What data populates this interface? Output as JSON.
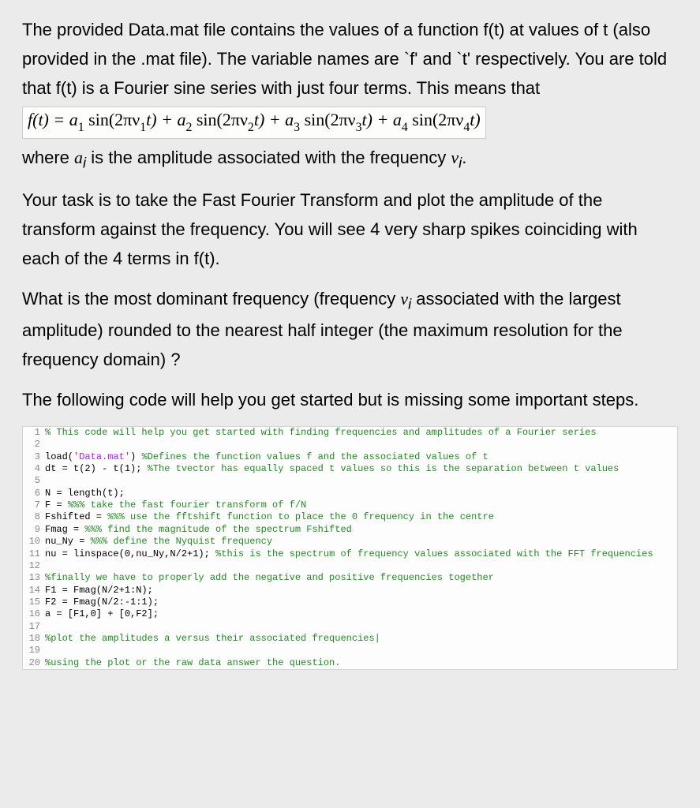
{
  "p1_a": "The provided Data.mat file contains the values of a function f(t) at values of t (also provided in the .mat file). The variable names are `f' and `t' respectively. You are told that f(t) is a Fourier sine series with just four terms. This means that",
  "formula": {
    "lhs": "f(t) = ",
    "t1a": "a",
    "t1s": "1",
    "t1b": " sin(2πν",
    "t1c": "1",
    "t1d": "t) + ",
    "t2a": "a",
    "t2s": "2",
    "t2b": " sin(2πν",
    "t2c": "2",
    "t2d": "t) + ",
    "t3a": "a",
    "t3s": "3",
    "t3b": " sin(2πν",
    "t3c": "3",
    "t3d": "t) + ",
    "t4a": "a",
    "t4s": "4",
    "t4b": " sin(2πν",
    "t4c": "4",
    "t4d": "t)"
  },
  "p1_b_pre": " where ",
  "p1_b_ai": "a",
  "p1_b_sub": "i",
  "p1_b_mid": " is the amplitude associated with the frequency ",
  "p1_b_vi": "v",
  "p1_b_sub2": "i",
  "p1_b_end": ".",
  "p2": "Your task is to take the Fast Fourier Transform and plot the amplitude of the transform against the frequency. You will see 4 very sharp spikes coinciding with each of the 4 terms in f(t).",
  "p3_a": "What is the most dominant frequency (frequency ",
  "p3_v": "v",
  "p3_sub": "i",
  "p3_b": " associated with the largest amplitude) rounded to the nearest half integer (the maximum resolution for the frequency domain) ?",
  "p4": "The following code will help you get started but is missing some important steps.",
  "code": [
    {
      "n": "1",
      "segs": [
        {
          "t": "% This code will help you get started with finding frequencies and amplitudes of a Fourier series",
          "cls": "comment"
        }
      ]
    },
    {
      "n": "2",
      "segs": []
    },
    {
      "n": "3",
      "segs": [
        {
          "t": "load(",
          "cls": ""
        },
        {
          "t": "'Data.mat'",
          "cls": "str"
        },
        {
          "t": ") ",
          "cls": ""
        },
        {
          "t": "%Defines the function values f and the associated values of t",
          "cls": "comment"
        }
      ]
    },
    {
      "n": "4",
      "segs": [
        {
          "t": "dt = t(2) - t(1); ",
          "cls": ""
        },
        {
          "t": "%The tvector has equally spaced t values so this is the separation between t values",
          "cls": "comment"
        }
      ]
    },
    {
      "n": "5",
      "segs": []
    },
    {
      "n": "6",
      "segs": [
        {
          "t": "N = length(t);",
          "cls": ""
        }
      ]
    },
    {
      "n": "7",
      "segs": [
        {
          "t": "F = ",
          "cls": ""
        },
        {
          "t": "%%% take the fast fourier transform of f/N",
          "cls": "comment"
        }
      ]
    },
    {
      "n": "8",
      "segs": [
        {
          "t": "Fshifted = ",
          "cls": ""
        },
        {
          "t": "%%% use the fftshift function to place the 0 frequency in the centre",
          "cls": "comment"
        }
      ]
    },
    {
      "n": "9",
      "segs": [
        {
          "t": "Fmag = ",
          "cls": ""
        },
        {
          "t": "%%% find the magnitude of the spectrum Fshifted",
          "cls": "comment"
        }
      ]
    },
    {
      "n": "10",
      "segs": [
        {
          "t": "nu_Ny = ",
          "cls": ""
        },
        {
          "t": "%%% define the Nyquist frequency",
          "cls": "comment"
        }
      ]
    },
    {
      "n": "11",
      "segs": [
        {
          "t": "nu = linspace(0,nu_Ny,N/2+1); ",
          "cls": ""
        },
        {
          "t": "%this is the spectrum of frequency values associated with the FFT frequencies",
          "cls": "comment"
        }
      ]
    },
    {
      "n": "12",
      "segs": []
    },
    {
      "n": "13",
      "segs": [
        {
          "t": "%finally we have to properly add the negative and positive frequencies together",
          "cls": "comment"
        }
      ]
    },
    {
      "n": "14",
      "segs": [
        {
          "t": "F1 = Fmag(N/2+1:N);",
          "cls": ""
        }
      ]
    },
    {
      "n": "15",
      "segs": [
        {
          "t": "F2 = Fmag(N/2:-1:1);",
          "cls": ""
        }
      ]
    },
    {
      "n": "16",
      "segs": [
        {
          "t": "a = [F1,0] + [0,F2];",
          "cls": ""
        }
      ]
    },
    {
      "n": "17",
      "segs": []
    },
    {
      "n": "18",
      "segs": [
        {
          "t": "%plot the amplitudes a versus their associated frequencies|",
          "cls": "comment"
        }
      ]
    },
    {
      "n": "19",
      "segs": []
    },
    {
      "n": "20",
      "segs": [
        {
          "t": "%using the plot or the raw data answer the question.",
          "cls": "comment"
        }
      ]
    }
  ]
}
